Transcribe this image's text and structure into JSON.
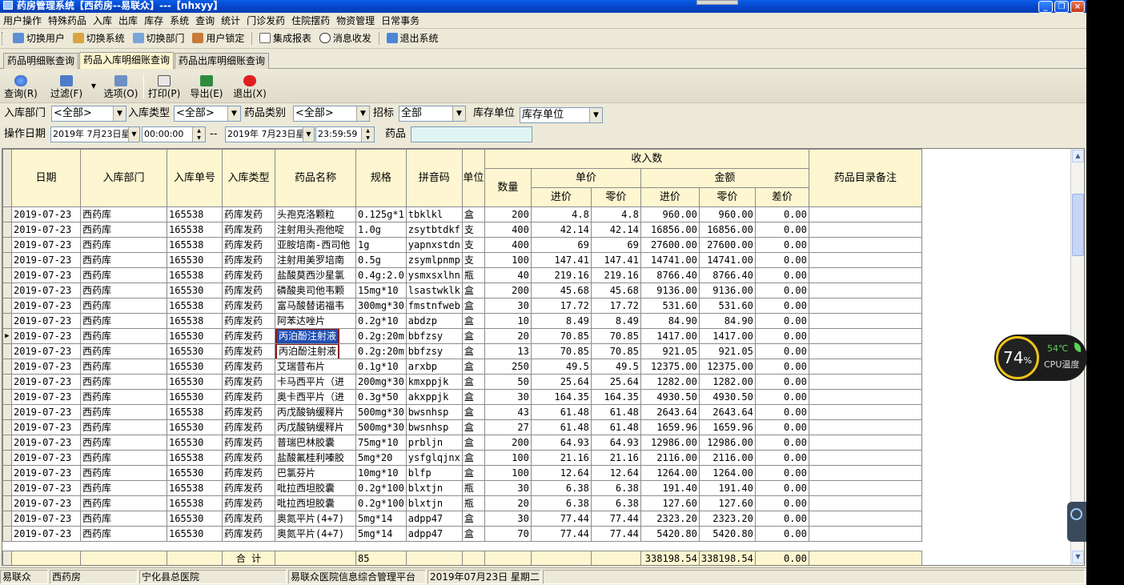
{
  "window": {
    "title": "药房管理系统【西药房--易联众】---【nhxyy】"
  },
  "menu": [
    "用户操作",
    "特殊药品",
    "入库",
    "出库",
    "库存",
    "系统",
    "查询",
    "统计",
    "门诊发药",
    "住院摆药",
    "物资管理",
    "日常事务"
  ],
  "quickbar": [
    {
      "label": "切换用户",
      "icon": "switch-user-icon"
    },
    {
      "label": "切换系统",
      "icon": "switch-system-icon"
    },
    {
      "label": "切换部门",
      "icon": "switch-department-icon"
    },
    {
      "label": "用户锁定",
      "icon": "user-lock-icon"
    },
    {
      "label": "集成报表",
      "icon": "report-icon"
    },
    {
      "label": "消息收发",
      "icon": "message-icon"
    },
    {
      "label": "退出系统",
      "icon": "exit-system-icon"
    }
  ],
  "tabs": [
    "药品明细账查询",
    "药品入库明细账查询",
    "药品出库明细账查询"
  ],
  "toolbar": {
    "query": "查询(R)",
    "filter": "过滤(F)",
    "options": "选项(O)",
    "print": "打印(P)",
    "export": "导出(E)",
    "exit": "退出(X)"
  },
  "filters": {
    "dept_label": "入库部门",
    "dept_value": "<全部>",
    "type_label": "入库类型",
    "type_value": "<全部>",
    "cat_label": "药品类别",
    "cat_value": "<全部>",
    "bid_label": "招标",
    "bid_value": "全部",
    "unit_label": "库存单位",
    "unit_value": "库存单位",
    "date_label": "操作日期",
    "date_from": "2019年 7月23日星",
    "time_from": "00:00:00",
    "dash": "--",
    "date_to": "2019年 7月23日星",
    "time_to": "23:59:59",
    "drug_label": "药品",
    "drug_value": ""
  },
  "grid": {
    "headers": {
      "date": "日期",
      "dept": "入库部门",
      "no": "入库单号",
      "type": "入库类型",
      "name": "药品名称",
      "spec": "规格",
      "pinyin": "拼音码",
      "unit": "单位",
      "income": "收入数",
      "qty": "数量",
      "price": "单价",
      "amount": "金额",
      "buy": "进价",
      "retail": "零价",
      "diff": "差价",
      "remark": "药品目录备注"
    },
    "rows": [
      [
        "2019-07-23",
        "西药库",
        "165538",
        "药库发药",
        "头孢克洛颗粒",
        "0.125g*1",
        "tbklkl",
        "盒",
        "200",
        "4.8",
        "4.8",
        "960.00",
        "960.00",
        "0.00"
      ],
      [
        "2019-07-23",
        "西药库",
        "165538",
        "药库发药",
        "注射用头孢他啶",
        "1.0g",
        "zsytbtdkf",
        "支",
        "400",
        "42.14",
        "42.14",
        "16856.00",
        "16856.00",
        "0.00"
      ],
      [
        "2019-07-23",
        "西药库",
        "165538",
        "药库发药",
        "亚胺培南-西司他",
        "1g",
        "yapnxstdn",
        "支",
        "400",
        "69",
        "69",
        "27600.00",
        "27600.00",
        "0.00"
      ],
      [
        "2019-07-23",
        "西药库",
        "165530",
        "药库发药",
        "注射用美罗培南",
        "0.5g",
        "zsymlpnmp",
        "支",
        "100",
        "147.41",
        "147.41",
        "14741.00",
        "14741.00",
        "0.00"
      ],
      [
        "2019-07-23",
        "西药库",
        "165538",
        "药库发药",
        "盐酸莫西沙星氯",
        "0.4g:2.0",
        "ysmxsxlhn",
        "瓶",
        "40",
        "219.16",
        "219.16",
        "8766.40",
        "8766.40",
        "0.00"
      ],
      [
        "2019-07-23",
        "西药库",
        "165530",
        "药库发药",
        "磷酸奥司他韦颗",
        "15mg*10",
        "lsastwklk",
        "盒",
        "200",
        "45.68",
        "45.68",
        "9136.00",
        "9136.00",
        "0.00"
      ],
      [
        "2019-07-23",
        "西药库",
        "165538",
        "药库发药",
        "富马酸替诺福韦",
        "300mg*30",
        "fmstnfweb",
        "盒",
        "30",
        "17.72",
        "17.72",
        "531.60",
        "531.60",
        "0.00"
      ],
      [
        "2019-07-23",
        "西药库",
        "165538",
        "药库发药",
        "阿苯达唑片",
        "0.2g*10",
        "abdzp",
        "盒",
        "10",
        "8.49",
        "8.49",
        "84.90",
        "84.90",
        "0.00"
      ],
      [
        "2019-07-23",
        "西药库",
        "165530",
        "药库发药",
        "丙泊酚注射液",
        "0.2g:20m",
        "bbfzsy",
        "盒",
        "20",
        "70.85",
        "70.85",
        "1417.00",
        "1417.00",
        "0.00"
      ],
      [
        "2019-07-23",
        "西药库",
        "165530",
        "药库发药",
        "丙泊酚注射液",
        "0.2g:20m",
        "bbfzsy",
        "盒",
        "13",
        "70.85",
        "70.85",
        "921.05",
        "921.05",
        "0.00"
      ],
      [
        "2019-07-23",
        "西药库",
        "165530",
        "药库发药",
        "艾瑞昔布片",
        "0.1g*10",
        "arxbp",
        "盒",
        "250",
        "49.5",
        "49.5",
        "12375.00",
        "12375.00",
        "0.00"
      ],
      [
        "2019-07-23",
        "西药库",
        "165530",
        "药库发药",
        "卡马西平片（进",
        "200mg*30",
        "kmxppjk",
        "盒",
        "50",
        "25.64",
        "25.64",
        "1282.00",
        "1282.00",
        "0.00"
      ],
      [
        "2019-07-23",
        "西药库",
        "165530",
        "药库发药",
        "奥卡西平片（进",
        "0.3g*50",
        "akxppjk",
        "盒",
        "30",
        "164.35",
        "164.35",
        "4930.50",
        "4930.50",
        "0.00"
      ],
      [
        "2019-07-23",
        "西药库",
        "165538",
        "药库发药",
        "丙戊酸钠缓释片",
        "500mg*30",
        "bwsnhsp",
        "盒",
        "43",
        "61.48",
        "61.48",
        "2643.64",
        "2643.64",
        "0.00"
      ],
      [
        "2019-07-23",
        "西药库",
        "165530",
        "药库发药",
        "丙戊酸钠缓释片",
        "500mg*30",
        "bwsnhsp",
        "盒",
        "27",
        "61.48",
        "61.48",
        "1659.96",
        "1659.96",
        "0.00"
      ],
      [
        "2019-07-23",
        "西药库",
        "165530",
        "药库发药",
        "普瑞巴林胶囊",
        "75mg*10",
        "prbljn",
        "盒",
        "200",
        "64.93",
        "64.93",
        "12986.00",
        "12986.00",
        "0.00"
      ],
      [
        "2019-07-23",
        "西药库",
        "165538",
        "药库发药",
        "盐酸氟桂利嗪胶",
        "5mg*20",
        "ysfglqjnx",
        "盒",
        "100",
        "21.16",
        "21.16",
        "2116.00",
        "2116.00",
        "0.00"
      ],
      [
        "2019-07-23",
        "西药库",
        "165530",
        "药库发药",
        "巴氯芬片",
        "10mg*10",
        "blfp",
        "盒",
        "100",
        "12.64",
        "12.64",
        "1264.00",
        "1264.00",
        "0.00"
      ],
      [
        "2019-07-23",
        "西药库",
        "165538",
        "药库发药",
        "吡拉西坦胶囊",
        "0.2g*100",
        "blxtjn",
        "瓶",
        "30",
        "6.38",
        "6.38",
        "191.40",
        "191.40",
        "0.00"
      ],
      [
        "2019-07-23",
        "西药库",
        "165538",
        "药库发药",
        "吡拉西坦胶囊",
        "0.2g*100",
        "blxtjn",
        "瓶",
        "20",
        "6.38",
        "6.38",
        "127.60",
        "127.60",
        "0.00"
      ],
      [
        "2019-07-23",
        "西药库",
        "165530",
        "药库发药",
        "奥氮平片(4+7)",
        "5mg*14",
        "adpp47",
        "盒",
        "30",
        "77.44",
        "77.44",
        "2323.20",
        "2323.20",
        "0.00"
      ],
      [
        "2019-07-23",
        "西药库",
        "165530",
        "药库发药",
        "奥氮平片(4+7)",
        "5mg*14",
        "adpp47",
        "盒",
        "70",
        "77.44",
        "77.44",
        "5420.80",
        "5420.80",
        "0.00"
      ]
    ],
    "total_label": "合  计",
    "total_count": "85",
    "total_buy": "338198.54",
    "total_retail": "338198.54",
    "total_diff": "0.00"
  },
  "statusbar": [
    "易联众",
    "西药房",
    "宁化县总医院",
    "易联众医院信息综合管理平台",
    "2019年07月23日 星期二"
  ],
  "cpu_widget": {
    "percent": "74",
    "percent_sign": "%",
    "temp": "54℃",
    "label": "CPU温度"
  }
}
